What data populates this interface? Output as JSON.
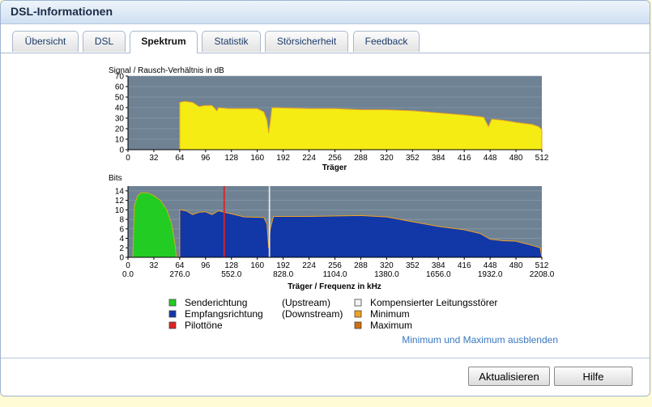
{
  "window": {
    "title": "DSL-Informationen"
  },
  "tabs": [
    {
      "label": "Übersicht"
    },
    {
      "label": "DSL"
    },
    {
      "label": "Spektrum",
      "active": true
    },
    {
      "label": "Statistik"
    },
    {
      "label": "Störsicherheit"
    },
    {
      "label": "Feedback"
    }
  ],
  "colors": {
    "plot_bg": "#6e8294",
    "snr_fill": "#f5ec14",
    "snr_edge": "#e8a020",
    "upstream": "#22cc22",
    "downstream": "#1238a8",
    "pilot": "#dd2222",
    "compensated": "#e6e6e6",
    "minimum": "#f0a020",
    "maximum": "#d07010",
    "link": "#3a78c0"
  },
  "chart_data": [
    {
      "type": "area",
      "title": "Signal / Rausch-Verhältnis in dB",
      "xlabel": "Träger",
      "ylabel": "",
      "xlim": [
        0,
        512
      ],
      "ylim": [
        0,
        70
      ],
      "x_ticks": [
        0,
        32,
        64,
        96,
        128,
        160,
        192,
        224,
        256,
        288,
        320,
        352,
        384,
        416,
        448,
        480,
        512
      ],
      "y_ticks": [
        0,
        10,
        20,
        30,
        40,
        50,
        60,
        70
      ],
      "series": [
        {
          "key": "snr",
          "points": [
            [
              0,
              0
            ],
            [
              64,
              0
            ],
            [
              64,
              45
            ],
            [
              70,
              46
            ],
            [
              80,
              45
            ],
            [
              88,
              41
            ],
            [
              95,
              42
            ],
            [
              104,
              42
            ],
            [
              110,
              37
            ],
            [
              112,
              40
            ],
            [
              124,
              39
            ],
            [
              160,
              39
            ],
            [
              168,
              36
            ],
            [
              172,
              28
            ],
            [
              174,
              16
            ],
            [
              176,
              27
            ],
            [
              178,
              40
            ],
            [
              224,
              39
            ],
            [
              256,
              39
            ],
            [
              288,
              38
            ],
            [
              320,
              38
            ],
            [
              352,
              37
            ],
            [
              384,
              35
            ],
            [
              416,
              33
            ],
            [
              440,
              31
            ],
            [
              446,
              22
            ],
            [
              450,
              29
            ],
            [
              464,
              28
            ],
            [
              480,
              26
            ],
            [
              500,
              24
            ],
            [
              508,
              22
            ],
            [
              512,
              19
            ],
            [
              512,
              0
            ]
          ]
        }
      ]
    },
    {
      "type": "area",
      "title": "Bits",
      "xlabel": "Träger / Frequenz in kHz",
      "ylabel": "",
      "xlim": [
        0,
        512
      ],
      "ylim": [
        0,
        15
      ],
      "x_ticks": [
        0,
        32,
        64,
        96,
        128,
        160,
        192,
        224,
        256,
        288,
        320,
        352,
        384,
        416,
        448,
        480,
        512
      ],
      "x_freq_labels": [
        "0.0",
        "276.0",
        "552.0",
        "828.0",
        "1104.0",
        "1380.0",
        "1656.0",
        "1932.0",
        "2208.0"
      ],
      "y_ticks": [
        0,
        2,
        4,
        6,
        8,
        10,
        12,
        14
      ],
      "series": [
        {
          "key": "upstream",
          "points": [
            [
              6,
              0
            ],
            [
              8,
              11
            ],
            [
              12,
              13
            ],
            [
              16,
              13.6
            ],
            [
              24,
              13.6
            ],
            [
              32,
              13
            ],
            [
              40,
              12
            ],
            [
              48,
              10
            ],
            [
              54,
              7
            ],
            [
              58,
              3
            ],
            [
              60,
              0
            ]
          ]
        },
        {
          "key": "downstream",
          "points": [
            [
              64,
              0
            ],
            [
              64,
              10
            ],
            [
              72,
              9.8
            ],
            [
              80,
              9
            ],
            [
              88,
              9.5
            ],
            [
              96,
              9.6
            ],
            [
              104,
              9
            ],
            [
              112,
              9.8
            ],
            [
              124,
              9.3
            ],
            [
              144,
              8.5
            ],
            [
              168,
              8.4
            ],
            [
              172,
              7
            ],
            [
              174,
              2
            ],
            [
              176,
              6
            ],
            [
              180,
              8.6
            ],
            [
              224,
              8.6
            ],
            [
              288,
              8.8
            ],
            [
              320,
              8.5
            ],
            [
              352,
              7.5
            ],
            [
              384,
              6.5
            ],
            [
              416,
              5.8
            ],
            [
              436,
              5
            ],
            [
              448,
              3.8
            ],
            [
              464,
              3.5
            ],
            [
              480,
              3.4
            ],
            [
              500,
              2.5
            ],
            [
              510,
              2
            ],
            [
              512,
              0
            ]
          ]
        }
      ],
      "markers": [
        {
          "key": "pilot",
          "x": 119
        },
        {
          "key": "compensated",
          "x": 175
        }
      ]
    }
  ],
  "legend": [
    {
      "key": "upstream",
      "label": "Senderichtung",
      "sub": "(Upstream)"
    },
    {
      "key": "downstream",
      "label": "Empfangsrichtung",
      "sub": "(Downstream)"
    },
    {
      "key": "pilot",
      "label": "Pilottöne",
      "sub": ""
    },
    {
      "key": "compensated",
      "label": "Kompensierter Leitungsstörer",
      "sub": ""
    },
    {
      "key": "minimum",
      "label": "Minimum",
      "sub": ""
    },
    {
      "key": "maximum",
      "label": "Maximum",
      "sub": ""
    }
  ],
  "toggle_link": "Minimum und Maximum ausblenden",
  "buttons": {
    "refresh": "Aktualisieren",
    "help": "Hilfe"
  }
}
